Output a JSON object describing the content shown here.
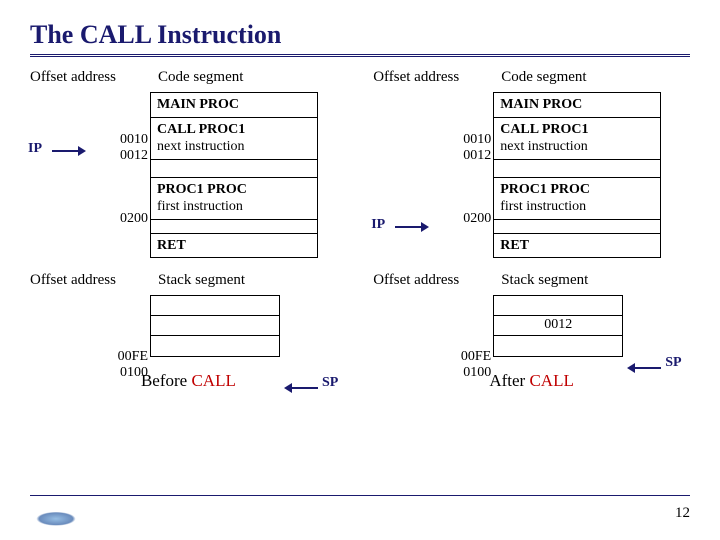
{
  "title": "The CALL Instruction",
  "page_number": "12",
  "headers": {
    "offset_address": "Offset address",
    "code_segment": "Code segment",
    "stack_segment": "Stack segment"
  },
  "labels": {
    "ip": "IP",
    "sp": "SP"
  },
  "code_seg": {
    "main_proc": "MAIN PROC",
    "call_proc1": "CALL PROC1",
    "next_instr": "next instruction",
    "proc1_proc": "PROC1 PROC",
    "first_instr": "first instruction",
    "ret": "RET"
  },
  "addr": {
    "a0010": "0010",
    "a0012": "0012",
    "a0200": "0200",
    "a00FE": "00FE",
    "a0100": "0100"
  },
  "stack_after_value": "0012",
  "captions": {
    "before_word": "Before ",
    "after_word": "After ",
    "call_word": "CALL"
  }
}
